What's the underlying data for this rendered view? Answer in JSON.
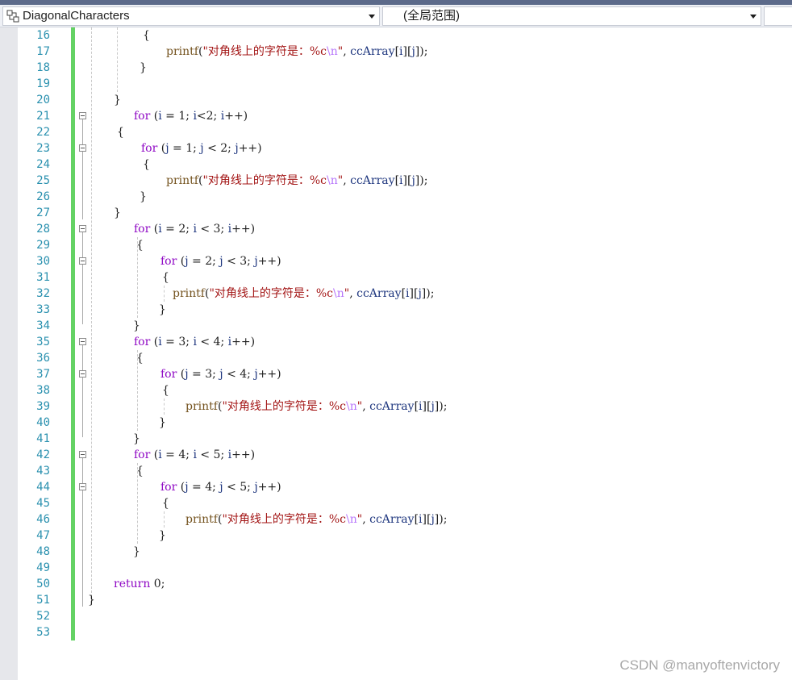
{
  "navigation": {
    "scope_dropdown": {
      "value": "DiagonalCharacters",
      "icon": "class-icon"
    },
    "member_dropdown": {
      "value": "(全局范围)"
    }
  },
  "editor": {
    "lines": [
      {
        "n": "16",
        "fold": false,
        "indent": 177,
        "tokens": [
          [
            "p",
            "{"
          ]
        ]
      },
      {
        "n": "17",
        "fold": false,
        "indent": 206,
        "tokens": [
          [
            "fn",
            "printf"
          ],
          [
            "p",
            "("
          ],
          [
            "str",
            "\"对角线上的字符是：%c"
          ],
          [
            "esc",
            "\\n"
          ],
          [
            "str",
            "\""
          ],
          [
            "p",
            ", "
          ],
          [
            "var",
            "ccArray"
          ],
          [
            "p",
            "["
          ],
          [
            "var",
            "i"
          ],
          [
            "p",
            "]["
          ],
          [
            "var",
            "j"
          ],
          [
            "p",
            "]);"
          ]
        ]
      },
      {
        "n": "18",
        "fold": false,
        "indent": 173,
        "tokens": [
          [
            "p",
            "}"
          ]
        ]
      },
      {
        "n": "19",
        "fold": false,
        "indent": 0,
        "tokens": []
      },
      {
        "n": "20",
        "fold": false,
        "indent": 141,
        "tokens": [
          [
            "p",
            "}"
          ]
        ]
      },
      {
        "n": "21",
        "fold": true,
        "indent": 166,
        "tokens": [
          [
            "kw",
            "for"
          ],
          [
            "p",
            " ("
          ],
          [
            "var",
            "i"
          ],
          [
            "p",
            " = 1; "
          ],
          [
            "var",
            "i"
          ],
          [
            "p",
            "<2; "
          ],
          [
            "var",
            "i"
          ],
          [
            "p",
            "++)"
          ]
        ]
      },
      {
        "n": "22",
        "fold": false,
        "indent": 145,
        "tokens": [
          [
            "p",
            "{"
          ]
        ]
      },
      {
        "n": "23",
        "fold": true,
        "indent": 175,
        "tokens": [
          [
            "kw",
            "for"
          ],
          [
            "p",
            " ("
          ],
          [
            "var",
            "j"
          ],
          [
            "p",
            " = 1; "
          ],
          [
            "var",
            "j"
          ],
          [
            "p",
            " < 2; "
          ],
          [
            "var",
            "j"
          ],
          [
            "p",
            "++)"
          ]
        ]
      },
      {
        "n": "24",
        "fold": false,
        "indent": 177,
        "tokens": [
          [
            "p",
            "{"
          ]
        ]
      },
      {
        "n": "25",
        "fold": false,
        "indent": 206,
        "tokens": [
          [
            "fn",
            "printf"
          ],
          [
            "p",
            "("
          ],
          [
            "str",
            "\"对角线上的字符是：%c"
          ],
          [
            "esc",
            "\\n"
          ],
          [
            "str",
            "\""
          ],
          [
            "p",
            ", "
          ],
          [
            "var",
            "ccArray"
          ],
          [
            "p",
            "["
          ],
          [
            "var",
            "i"
          ],
          [
            "p",
            "]["
          ],
          [
            "var",
            "j"
          ],
          [
            "p",
            "]);"
          ]
        ]
      },
      {
        "n": "26",
        "fold": false,
        "indent": 173,
        "tokens": [
          [
            "p",
            "}"
          ]
        ]
      },
      {
        "n": "27",
        "fold": false,
        "indent": 141,
        "tokens": [
          [
            "p",
            "}"
          ]
        ]
      },
      {
        "n": "28",
        "fold": true,
        "indent": 166,
        "tokens": [
          [
            "kw",
            "for"
          ],
          [
            "p",
            " ("
          ],
          [
            "var",
            "i"
          ],
          [
            "p",
            " = 2; "
          ],
          [
            "var",
            "i"
          ],
          [
            "p",
            " < 3; "
          ],
          [
            "var",
            "i"
          ],
          [
            "p",
            "++)"
          ]
        ]
      },
      {
        "n": "29",
        "fold": false,
        "indent": 169,
        "tokens": [
          [
            "p",
            "{"
          ]
        ]
      },
      {
        "n": "30",
        "fold": true,
        "indent": 199,
        "tokens": [
          [
            "kw",
            "for"
          ],
          [
            "p",
            " ("
          ],
          [
            "var",
            "j"
          ],
          [
            "p",
            " = 2; "
          ],
          [
            "var",
            "j"
          ],
          [
            "p",
            " < 3; "
          ],
          [
            "var",
            "j"
          ],
          [
            "p",
            "++)"
          ]
        ]
      },
      {
        "n": "31",
        "fold": false,
        "indent": 201,
        "tokens": [
          [
            "p",
            "{"
          ]
        ]
      },
      {
        "n": "32",
        "fold": false,
        "indent": 214,
        "tokens": [
          [
            "fn",
            "printf"
          ],
          [
            "p",
            "("
          ],
          [
            "str",
            "\"对角线上的字符是：%c"
          ],
          [
            "esc",
            "\\n"
          ],
          [
            "str",
            "\""
          ],
          [
            "p",
            ", "
          ],
          [
            "var",
            "ccArray"
          ],
          [
            "p",
            "["
          ],
          [
            "var",
            "i"
          ],
          [
            "p",
            "]["
          ],
          [
            "var",
            "j"
          ],
          [
            "p",
            "]);"
          ]
        ]
      },
      {
        "n": "33",
        "fold": false,
        "indent": 197,
        "tokens": [
          [
            "p",
            "}"
          ]
        ]
      },
      {
        "n": "34",
        "fold": false,
        "indent": 165,
        "tokens": [
          [
            "p",
            "}"
          ]
        ]
      },
      {
        "n": "35",
        "fold": true,
        "indent": 166,
        "tokens": [
          [
            "kw",
            "for"
          ],
          [
            "p",
            " ("
          ],
          [
            "var",
            "i"
          ],
          [
            "p",
            " = 3; "
          ],
          [
            "var",
            "i"
          ],
          [
            "p",
            " < 4; "
          ],
          [
            "var",
            "i"
          ],
          [
            "p",
            "++)"
          ]
        ]
      },
      {
        "n": "36",
        "fold": false,
        "indent": 169,
        "tokens": [
          [
            "p",
            "{"
          ]
        ]
      },
      {
        "n": "37",
        "fold": true,
        "indent": 199,
        "tokens": [
          [
            "kw",
            "for"
          ],
          [
            "p",
            " ("
          ],
          [
            "var",
            "j"
          ],
          [
            "p",
            " = 3; "
          ],
          [
            "var",
            "j"
          ],
          [
            "p",
            " < 4; "
          ],
          [
            "var",
            "j"
          ],
          [
            "p",
            "++)"
          ]
        ]
      },
      {
        "n": "38",
        "fold": false,
        "indent": 201,
        "tokens": [
          [
            "p",
            "{"
          ]
        ]
      },
      {
        "n": "39",
        "fold": false,
        "indent": 230,
        "tokens": [
          [
            "fn",
            "printf"
          ],
          [
            "p",
            "("
          ],
          [
            "str",
            "\"对角线上的字符是：%c"
          ],
          [
            "esc",
            "\\n"
          ],
          [
            "str",
            "\""
          ],
          [
            "p",
            ", "
          ],
          [
            "var",
            "ccArray"
          ],
          [
            "p",
            "["
          ],
          [
            "var",
            "i"
          ],
          [
            "p",
            "]["
          ],
          [
            "var",
            "j"
          ],
          [
            "p",
            "]);"
          ]
        ]
      },
      {
        "n": "40",
        "fold": false,
        "indent": 197,
        "tokens": [
          [
            "p",
            "}"
          ]
        ]
      },
      {
        "n": "41",
        "fold": false,
        "indent": 165,
        "tokens": [
          [
            "p",
            "}"
          ]
        ]
      },
      {
        "n": "42",
        "fold": true,
        "indent": 166,
        "tokens": [
          [
            "kw",
            "for"
          ],
          [
            "p",
            " ("
          ],
          [
            "var",
            "i"
          ],
          [
            "p",
            " = 4; "
          ],
          [
            "var",
            "i"
          ],
          [
            "p",
            " < 5; "
          ],
          [
            "var",
            "i"
          ],
          [
            "p",
            "++)"
          ]
        ]
      },
      {
        "n": "43",
        "fold": false,
        "indent": 169,
        "tokens": [
          [
            "p",
            "{"
          ]
        ]
      },
      {
        "n": "44",
        "fold": true,
        "indent": 199,
        "tokens": [
          [
            "kw",
            "for"
          ],
          [
            "p",
            " ("
          ],
          [
            "var",
            "j"
          ],
          [
            "p",
            " = 4; "
          ],
          [
            "var",
            "j"
          ],
          [
            "p",
            " < 5; "
          ],
          [
            "var",
            "j"
          ],
          [
            "p",
            "++)"
          ]
        ]
      },
      {
        "n": "45",
        "fold": false,
        "indent": 201,
        "tokens": [
          [
            "p",
            "{"
          ]
        ]
      },
      {
        "n": "46",
        "fold": false,
        "indent": 230,
        "tokens": [
          [
            "fn",
            "printf"
          ],
          [
            "p",
            "("
          ],
          [
            "str",
            "\"对角线上的字符是：%c"
          ],
          [
            "esc",
            "\\n"
          ],
          [
            "str",
            "\""
          ],
          [
            "p",
            ", "
          ],
          [
            "var",
            "ccArray"
          ],
          [
            "p",
            "["
          ],
          [
            "var",
            "i"
          ],
          [
            "p",
            "]["
          ],
          [
            "var",
            "j"
          ],
          [
            "p",
            "]);"
          ]
        ]
      },
      {
        "n": "47",
        "fold": false,
        "indent": 197,
        "tokens": [
          [
            "p",
            "}"
          ]
        ]
      },
      {
        "n": "48",
        "fold": false,
        "indent": 165,
        "tokens": [
          [
            "p",
            "}"
          ]
        ]
      },
      {
        "n": "49",
        "fold": false,
        "indent": 0,
        "tokens": []
      },
      {
        "n": "50",
        "fold": false,
        "indent": 141,
        "tokens": [
          [
            "kw",
            "return"
          ],
          [
            "p",
            " 0;"
          ]
        ]
      },
      {
        "n": "51",
        "fold": false,
        "indent": 109,
        "tokens": [
          [
            "p",
            "}"
          ]
        ]
      },
      {
        "n": "52",
        "fold": false,
        "indent": 0,
        "tokens": []
      },
      {
        "n": "53",
        "fold": false,
        "indent": 0,
        "tokens": []
      }
    ]
  },
  "watermark": "CSDN @manyoftenvictory",
  "colors": {
    "keyword": "#8f08c4",
    "function": "#74531f",
    "string": "#a31515",
    "escape": "#b776fb",
    "identifier": "#1f377f",
    "line_number": "#2b91af",
    "change_bar": "#64d264"
  }
}
